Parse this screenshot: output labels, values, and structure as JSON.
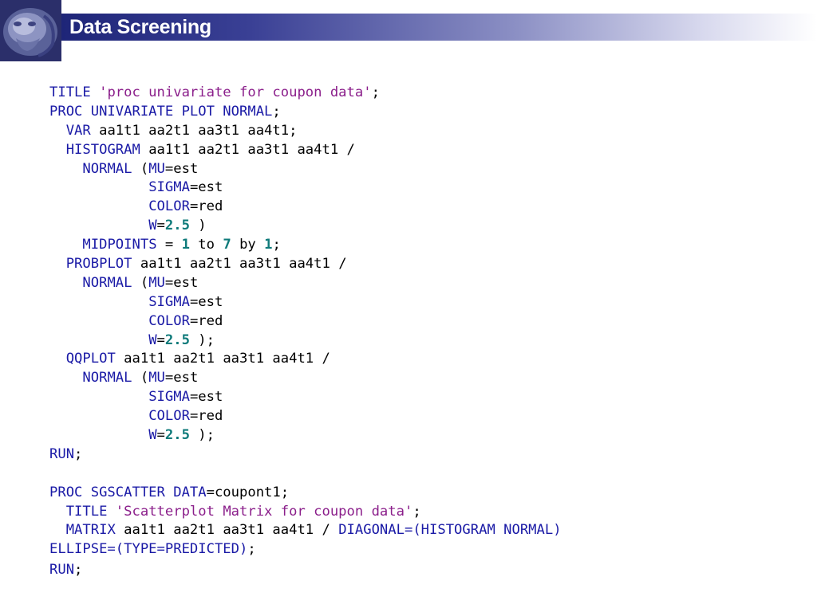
{
  "slide": {
    "title": "Data Screening",
    "logo": "lion-shrine-logo"
  },
  "code": {
    "lines": [
      [
        {
          "t": "kw",
          "v": "TITLE "
        },
        {
          "t": "str",
          "v": "'proc univariate for coupon data'"
        },
        {
          "t": "id",
          "v": ";"
        }
      ],
      [
        {
          "t": "kw",
          "v": "PROC UNIVARIATE PLOT NORMAL"
        },
        {
          "t": "id",
          "v": ";"
        }
      ],
      [
        {
          "t": "id",
          "v": "  "
        },
        {
          "t": "kw",
          "v": "VAR"
        },
        {
          "t": "id",
          "v": " aa1t1 aa2t1 aa3t1 aa4t1;"
        }
      ],
      [
        {
          "t": "id",
          "v": "  "
        },
        {
          "t": "kw",
          "v": "HISTOGRAM"
        },
        {
          "t": "id",
          "v": " aa1t1 aa2t1 aa3t1 aa4t1 /"
        }
      ],
      [
        {
          "t": "id",
          "v": "    "
        },
        {
          "t": "kw",
          "v": "NORMAL"
        },
        {
          "t": "id",
          "v": " ("
        },
        {
          "t": "kw",
          "v": "MU"
        },
        {
          "t": "id",
          "v": "=est"
        }
      ],
      [
        {
          "t": "id",
          "v": "            "
        },
        {
          "t": "kw",
          "v": "SIGMA"
        },
        {
          "t": "id",
          "v": "=est"
        }
      ],
      [
        {
          "t": "id",
          "v": "            "
        },
        {
          "t": "kw",
          "v": "COLOR"
        },
        {
          "t": "id",
          "v": "=red"
        }
      ],
      [
        {
          "t": "id",
          "v": "            "
        },
        {
          "t": "kw",
          "v": "W"
        },
        {
          "t": "id",
          "v": "="
        },
        {
          "t": "num",
          "v": "2.5"
        },
        {
          "t": "id",
          "v": " )"
        }
      ],
      [
        {
          "t": "id",
          "v": "    "
        },
        {
          "t": "kw",
          "v": "MIDPOINTS"
        },
        {
          "t": "id",
          "v": " = "
        },
        {
          "t": "num",
          "v": "1"
        },
        {
          "t": "id",
          "v": " to "
        },
        {
          "t": "num",
          "v": "7"
        },
        {
          "t": "id",
          "v": " by "
        },
        {
          "t": "num",
          "v": "1"
        },
        {
          "t": "id",
          "v": ";"
        }
      ],
      [
        {
          "t": "id",
          "v": "  "
        },
        {
          "t": "kw",
          "v": "PROBPLOT"
        },
        {
          "t": "id",
          "v": " aa1t1 aa2t1 aa3t1 aa4t1 /"
        }
      ],
      [
        {
          "t": "id",
          "v": "    "
        },
        {
          "t": "kw",
          "v": "NORMAL"
        },
        {
          "t": "id",
          "v": " ("
        },
        {
          "t": "kw",
          "v": "MU"
        },
        {
          "t": "id",
          "v": "=est"
        }
      ],
      [
        {
          "t": "id",
          "v": "            "
        },
        {
          "t": "kw",
          "v": "SIGMA"
        },
        {
          "t": "id",
          "v": "=est"
        }
      ],
      [
        {
          "t": "id",
          "v": "            "
        },
        {
          "t": "kw",
          "v": "COLOR"
        },
        {
          "t": "id",
          "v": "=red"
        }
      ],
      [
        {
          "t": "id",
          "v": "            "
        },
        {
          "t": "kw",
          "v": "W"
        },
        {
          "t": "id",
          "v": "="
        },
        {
          "t": "num",
          "v": "2.5"
        },
        {
          "t": "id",
          "v": " );"
        }
      ],
      [
        {
          "t": "id",
          "v": "  "
        },
        {
          "t": "kw",
          "v": "QQPLOT"
        },
        {
          "t": "id",
          "v": " aa1t1 aa2t1 aa3t1 aa4t1 /"
        }
      ],
      [
        {
          "t": "id",
          "v": "    "
        },
        {
          "t": "kw",
          "v": "NORMAL"
        },
        {
          "t": "id",
          "v": " ("
        },
        {
          "t": "kw",
          "v": "MU"
        },
        {
          "t": "id",
          "v": "=est"
        }
      ],
      [
        {
          "t": "id",
          "v": "            "
        },
        {
          "t": "kw",
          "v": "SIGMA"
        },
        {
          "t": "id",
          "v": "=est"
        }
      ],
      [
        {
          "t": "id",
          "v": "            "
        },
        {
          "t": "kw",
          "v": "COLOR"
        },
        {
          "t": "id",
          "v": "=red"
        }
      ],
      [
        {
          "t": "id",
          "v": "            "
        },
        {
          "t": "kw",
          "v": "W"
        },
        {
          "t": "id",
          "v": "="
        },
        {
          "t": "num",
          "v": "2.5"
        },
        {
          "t": "id",
          "v": " );"
        }
      ],
      [
        {
          "t": "kw",
          "v": "RUN"
        },
        {
          "t": "id",
          "v": ";"
        }
      ],
      [
        {
          "t": "id",
          "v": ""
        }
      ],
      [
        {
          "t": "kw",
          "v": "PROC SGSCATTER DATA"
        },
        {
          "t": "id",
          "v": "=coupont1;"
        }
      ],
      [
        {
          "t": "id",
          "v": "  "
        },
        {
          "t": "kw",
          "v": "TITLE "
        },
        {
          "t": "str",
          "v": "'Scatterplot Matrix for coupon data'"
        },
        {
          "t": "id",
          "v": ";"
        }
      ],
      [
        {
          "t": "id",
          "v": "  "
        },
        {
          "t": "kw",
          "v": "MATRIX"
        },
        {
          "t": "id",
          "v": " aa1t1 aa2t1 aa3t1 aa4t1 / "
        },
        {
          "t": "kw",
          "v": "DIAGONAL=(HISTOGRAM NORMAL)"
        }
      ],
      [
        {
          "t": "kw",
          "v": "ELLIPSE=(TYPE=PREDICTED)"
        },
        {
          "t": "id",
          "v": ";"
        }
      ],
      [
        {
          "t": "kw",
          "v": "RUN"
        },
        {
          "t": "id",
          "v": ";"
        }
      ]
    ]
  },
  "colors": {
    "keyword": "#1a1aa6",
    "string": "#8b1f8b",
    "number": "#0e7a7a",
    "title_bar_start": "#1e2578"
  }
}
